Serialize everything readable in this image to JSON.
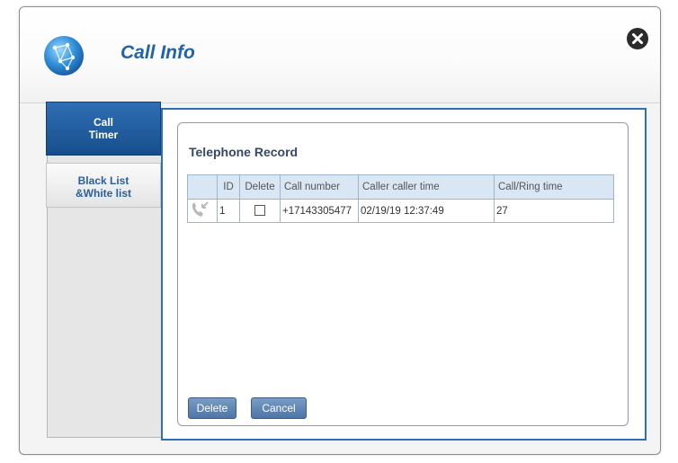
{
  "header": {
    "title": "Call Info"
  },
  "sidebar": {
    "items": [
      {
        "label_line1": "Call",
        "label_line2": "Timer"
      },
      {
        "label_line1": "Black List",
        "label_line2": "&White list"
      }
    ]
  },
  "record": {
    "title": "Telephone Record",
    "columns": [
      "ID",
      "Delete",
      "Call number",
      "Caller caller time",
      "Call/Ring time"
    ],
    "rows": [
      {
        "id": "1",
        "call_number": "+17143305477",
        "caller_time": "02/19/19 12:37:49",
        "ring_time": "27",
        "delete_checked": false
      }
    ]
  },
  "buttons": {
    "delete": "Delete",
    "cancel": "Cancel"
  },
  "colors": {
    "accent": "#2f6fb4",
    "title": "#2063a8",
    "table_header": "#d9e7f5"
  }
}
